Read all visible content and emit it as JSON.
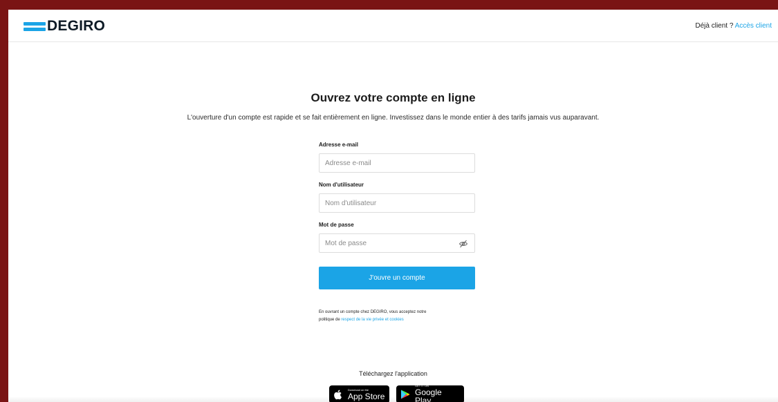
{
  "header": {
    "logo_text": "DEGIRO",
    "existing_client_text": "Déjà client ?",
    "client_access_link": "Accès client"
  },
  "main": {
    "title": "Ouvrez votre compte en ligne",
    "subtitle": "L'ouverture d'un compte est rapide et se fait entièrement en ligne. Investissez dans le monde entier à des tarifs jamais vus auparavant."
  },
  "form": {
    "email": {
      "label": "Adresse e-mail",
      "placeholder": "Adresse e-mail",
      "value": ""
    },
    "username": {
      "label": "Nom d'utilisateur",
      "placeholder": "Nom d'utilisateur",
      "value": ""
    },
    "password": {
      "label": "Mot de passe",
      "placeholder": "Mot de passe",
      "value": ""
    },
    "submit_label": "J'ouvre un compte"
  },
  "legal": {
    "text_line1": "En ouvrant un compte chez DEGIRO, vous acceptez notre",
    "text_line2_prefix": "politique de",
    "link_text": "respect de la vie privée et cookies"
  },
  "download": {
    "title": "Téléchargez l'application",
    "app_store_small": "Download on the",
    "app_store_big": "App Store",
    "google_play_small": "GET IT ON",
    "google_play_big": "Google Play"
  },
  "colors": {
    "accent": "#1ba4e6",
    "frame_border": "#7a1414",
    "text": "#1c1c1c"
  },
  "icons": [
    "logo-bars-icon",
    "eye-slash-icon",
    "apple-icon",
    "google-play-icon"
  ]
}
